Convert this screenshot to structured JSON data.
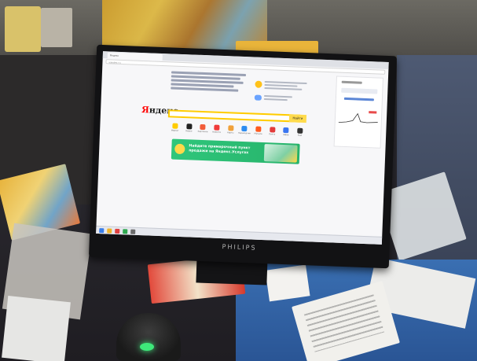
{
  "monitor": {
    "brand": "PHILIPS"
  },
  "browser": {
    "tab_title": "Яндекс",
    "address": "yandex.ru"
  },
  "yandex": {
    "logo_first_letter": "Я",
    "logo_rest": "ндекс",
    "search_button": "Найти",
    "banner_text": "Найдите примерочный пункт продажи на Яндекс.Услугах",
    "services": [
      {
        "name": "Маркет",
        "color": "#ffcc00"
      },
      {
        "name": "Видео",
        "color": "#222222"
      },
      {
        "name": "Картинки",
        "color": "#f25c3a"
      },
      {
        "name": "Новости",
        "color": "#f03a3a"
      },
      {
        "name": "Карты",
        "color": "#f0a13a"
      },
      {
        "name": "Переводчик",
        "color": "#2d8cf0"
      },
      {
        "name": "Музыка",
        "color": "#ff5a1e"
      },
      {
        "name": "Почта",
        "color": "#e23b3b"
      },
      {
        "name": "Эфир",
        "color": "#3a75f0"
      },
      {
        "name": "Ещё",
        "color": "#333333"
      }
    ]
  },
  "colors": {
    "yandex_red": "#ff0000",
    "search_yellow": "#ffcc00",
    "banner_green": "#2fc67b",
    "desk_blue": "#3a6fb2",
    "scanner_led": "#3ee87a"
  }
}
